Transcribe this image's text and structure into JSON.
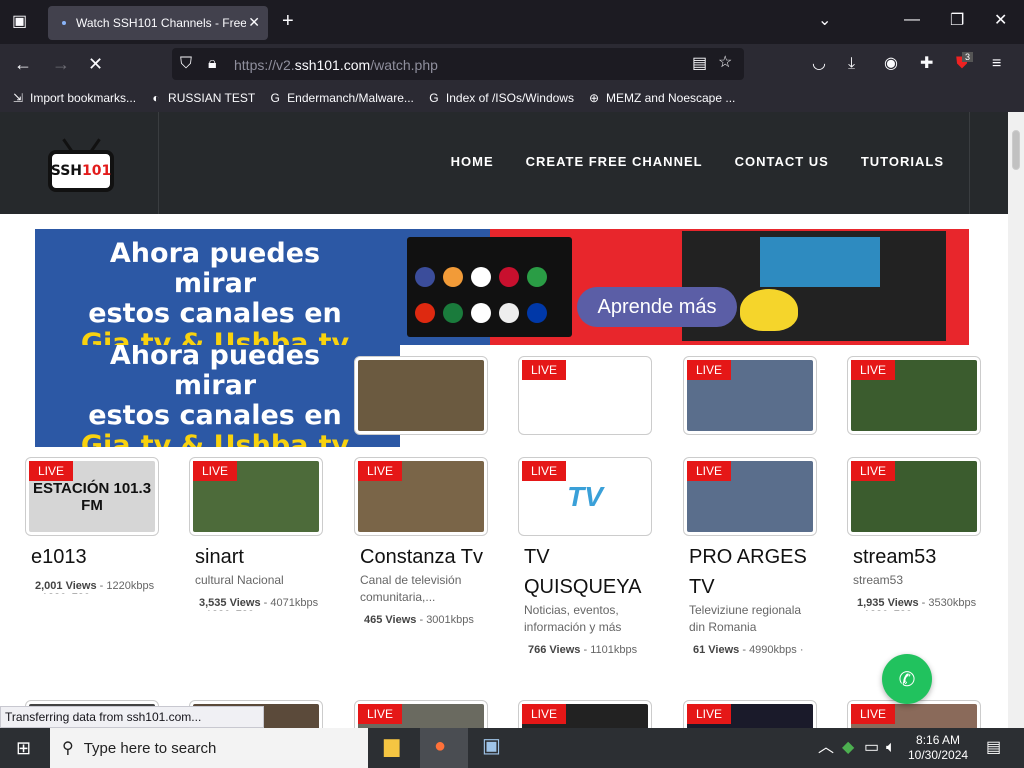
{
  "browser": {
    "tab_title": "Watch SSH101 Channels - Free",
    "url_prefix": "https://v2.",
    "url_domain": "ssh101.com",
    "url_path": "/watch.php",
    "extension_badge": "3",
    "bookmarks": [
      {
        "label": "Import bookmarks...",
        "icon": "import-icon"
      },
      {
        "label": "RUSSIAN TEST",
        "icon": "site-icon"
      },
      {
        "label": "Endermanch/Malware...",
        "icon": "github-icon"
      },
      {
        "label": "Index of /ISOs/Windows",
        "icon": "google-icon"
      },
      {
        "label": "MEMZ and Noescape ...",
        "icon": "globe-icon"
      }
    ],
    "status_text": "Transferring data from ssh101.com..."
  },
  "site": {
    "logo_text": "SSH",
    "logo_accent": "101",
    "nav": [
      "HOME",
      "CREATE FREE CHANNEL",
      "CONTACT US",
      "TUTORIALS"
    ]
  },
  "banner": {
    "line1": "Ahora puedes mirar",
    "line2": "estos canales en",
    "line3": "Gia.tv & Ushba.tv",
    "button": "Aprende más"
  },
  "live_label": "LIVE",
  "cards": [
    {
      "title": "e1013",
      "subtitle": "",
      "views": "2,001 Views",
      "extra": "1220kbps · 1280x720",
      "thumb_text": "ESTACIÓN 101.3 FM"
    },
    {
      "title": "sinart",
      "subtitle": "cultural Nacional",
      "views": "3,535 Views",
      "extra": "4071kbps · 1280x720",
      "thumb_text": ""
    },
    {
      "title": "Constanza Tv",
      "subtitle": "Canal de televisión comunitaria,...",
      "views": "465 Views",
      "extra": "3001kbps",
      "thumb_text": ""
    },
    {
      "title": "TV QUISQUEYA",
      "subtitle": "Noticias, eventos, información y más",
      "views": "766 Views",
      "extra": "1101kbps",
      "thumb_text": "TV"
    },
    {
      "title": "PRO ARGES TV",
      "subtitle": "Televiziune regionala din Romania",
      "views": "61 Views",
      "extra": "4990kbps ·",
      "thumb_text": ""
    },
    {
      "title": "stream53",
      "subtitle": "stream53",
      "views": "1,935 Views",
      "extra": "3530kbps · 1280x720",
      "thumb_text": ""
    }
  ],
  "taskbar": {
    "search_placeholder": "Type here to search",
    "time": "8:16 AM",
    "date": "10/30/2024"
  }
}
